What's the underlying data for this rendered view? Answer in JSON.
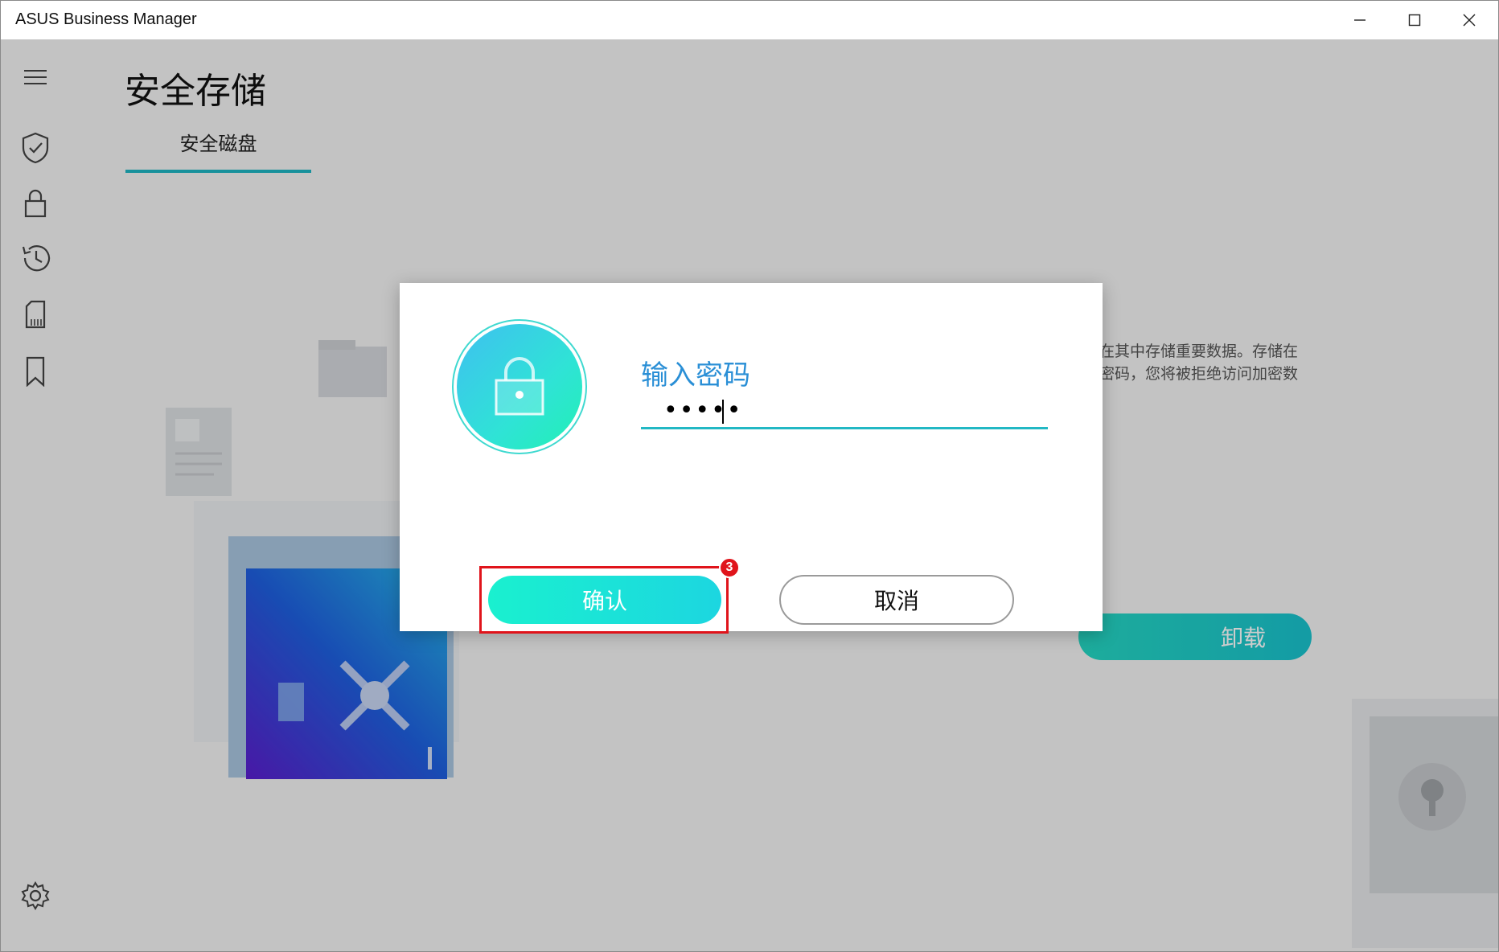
{
  "window": {
    "title": "ASUS Business Manager"
  },
  "sidebar": {
    "items": [
      {
        "icon": "menu-icon"
      },
      {
        "icon": "shield-check-icon"
      },
      {
        "icon": "lock-icon"
      },
      {
        "icon": "history-icon"
      },
      {
        "icon": "sd-card-icon"
      },
      {
        "icon": "bookmark-icon"
      },
      {
        "icon": "gear-icon"
      }
    ]
  },
  "main": {
    "title": "安全存储",
    "tabs": [
      {
        "label": "安全磁盘",
        "active": true
      }
    ],
    "description_lines": [
      "在其中存储重要数据。存储在",
      "密码，您将被拒绝访问加密数"
    ],
    "unmount_label": "卸载"
  },
  "dialog": {
    "title": "输入密码",
    "password_value": "•••••",
    "confirm_label": "确认",
    "cancel_label": "取消",
    "step_badge": "3"
  },
  "colors": {
    "accent": "#1fb6c4",
    "highlight": "#e0141b",
    "dialog_title": "#2a8fd6"
  }
}
